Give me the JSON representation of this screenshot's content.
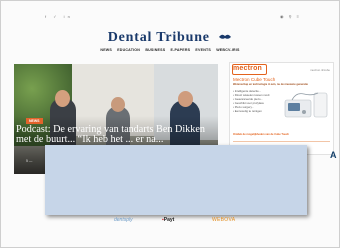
{
  "header": {
    "social_icons": [
      "facebook-icon",
      "twitter-icon",
      "linkedin-icon"
    ],
    "social_text": "f  ✓  in",
    "utility_icons": [
      "user-icon",
      "search-icon",
      "menu-icon"
    ],
    "utility_text": "◉  ⚲  ≡",
    "site_name": "Dental Tribune"
  },
  "nav": {
    "items": [
      "NEWS",
      "EDUCATION",
      "BUSINESS",
      "E-PAPERS",
      "EVENTS",
      "WEBCV-IRIS"
    ]
  },
  "hero": {
    "tag": "NEWS",
    "headline": "Podcast: De ervaring van tandarts Ben Dikken met de buurt... “Ik heb het ... er na...",
    "meta": "5  —"
  },
  "ad": {
    "brand": "mectron",
    "link": "mectron.nl/cube",
    "product": "Mectron Cube Touch",
    "subtitle": "Wetenschap en technologie in één, nu de nieuwste generatie",
    "features": [
      "• Intelligente detectie...",
      "• Direct wisselen tussen modi",
      "• Geavanceerde piezo...",
      "• Geschikt voor profylaxe",
      "• Piezo surgery...",
      "• Eenvoudig te reinigen"
    ],
    "lead": "Ontdek de mogelijkheden van de Cube Touch"
  },
  "partners": {
    "logo_1": "dentsply",
    "logo_2_mark": "▪",
    "logo_2": "Payt",
    "logo_3": "WEBOVA"
  },
  "colors": {
    "brand_navy": "#1a3a6b",
    "accent_orange": "#e3621c",
    "modal_bg": "#c6d5e8"
  }
}
